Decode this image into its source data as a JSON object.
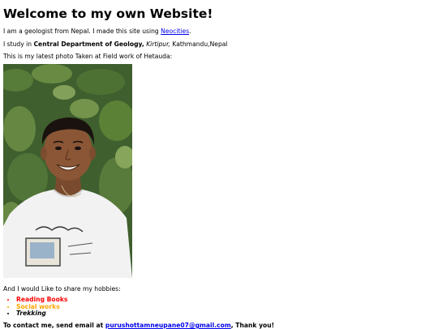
{
  "heading": "Welcome to my own Website!",
  "intro": {
    "text": "I am a geologist from Nepal. I made this site using",
    "link": "Neocities",
    "end": "."
  },
  "study": {
    "prefix": "I study in",
    "department": "Central Department of Geology,",
    "place": "Kirtipur,",
    "city": "Kathmandu,Nepal"
  },
  "photo_caption": "This is my latest photo Taken at Field work of Hetauda:",
  "hobbies_intro": "And I would Like to share my hobbies:",
  "hobbies": [
    {
      "label": "Reading Books",
      "color": "#ff0000"
    },
    {
      "label": "Social works",
      "color": "#ffa500"
    },
    {
      "label": "Trekking",
      "color": "#000000"
    }
  ],
  "contact": {
    "text": "To contact me, send email at",
    "email": "purushottamneupane07@gmail.com",
    "end": ", Thank you!"
  }
}
